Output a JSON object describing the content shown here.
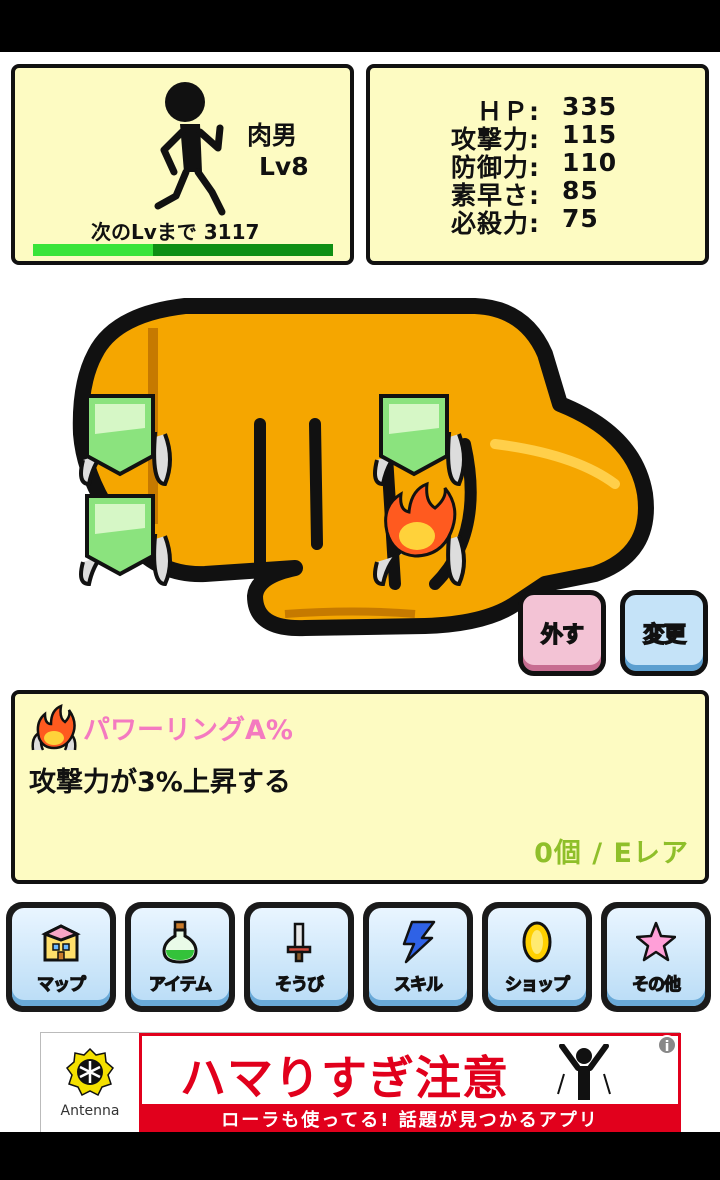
{
  "player": {
    "name": "肉男",
    "level": "Lv8",
    "exp_label": "次のLvまで 3117",
    "exp_progress": 0.4
  },
  "stats": [
    {
      "label": "ＨＰ:",
      "value": "335"
    },
    {
      "label": "攻撃力:",
      "value": "115"
    },
    {
      "label": "防御力:",
      "value": "110"
    },
    {
      "label": "素早さ:",
      "value": "85"
    },
    {
      "label": "必殺力:",
      "value": "75"
    }
  ],
  "fist": {
    "slots": [
      "empty-ring-icon",
      "empty-ring-icon",
      "empty-ring-icon",
      "fire-ring-icon"
    ]
  },
  "actions": {
    "remove_label": "外す",
    "change_label": "変更"
  },
  "item": {
    "icon": "fire-ring-icon",
    "name": "パワーリングA%",
    "description": "攻撃力が3%上昇する",
    "count_rarity": "0個 / Eレア"
  },
  "menu": [
    {
      "label": "マップ",
      "icon": "map-icon"
    },
    {
      "label": "アイテム",
      "icon": "potion-icon"
    },
    {
      "label": "そうび",
      "icon": "sword-icon"
    },
    {
      "label": "スキル",
      "icon": "lightning-icon"
    },
    {
      "label": "ショップ",
      "icon": "coin-icon"
    },
    {
      "label": "その他",
      "icon": "star-icon"
    }
  ],
  "ad": {
    "brand": "Antenna",
    "headline": "ハマりすぎ注意",
    "subline": "ローラも使ってる! 話題が見つかるアプリ",
    "info": "i"
  },
  "colors": {
    "panel_bg": "#fdfbc2",
    "fist": "#f5a600",
    "item_name": "#f47ac0",
    "count": "#8fbf2a",
    "ad_red": "#e1001c"
  }
}
